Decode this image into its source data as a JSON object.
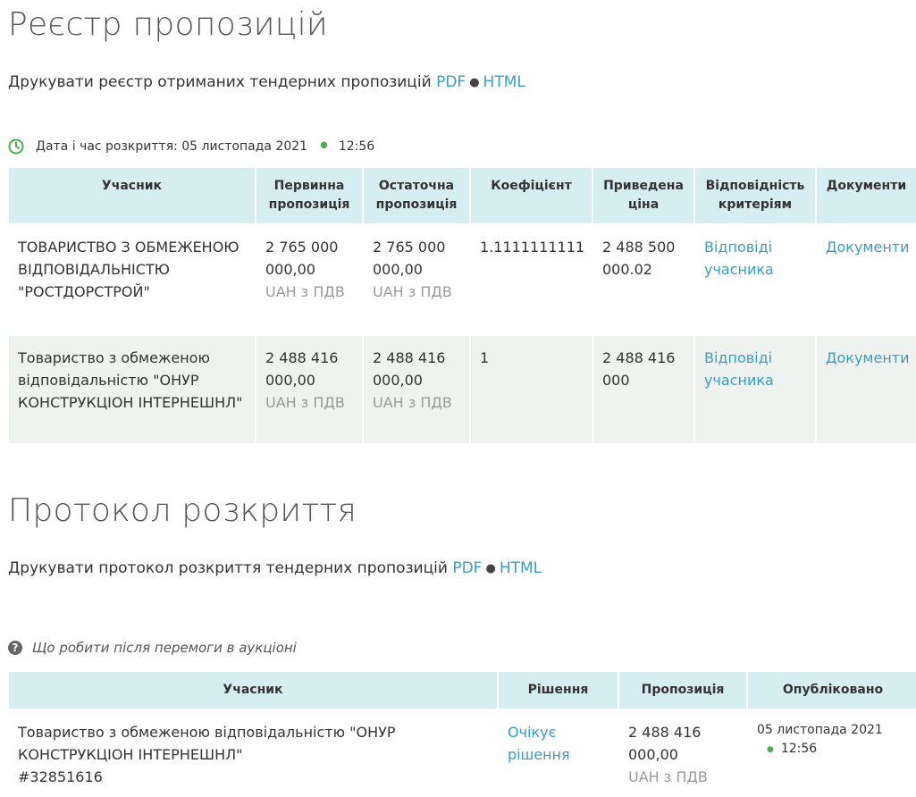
{
  "registry": {
    "title": "Реєстр пропозицій",
    "print_text": "Друкувати реєстр отриманих тендерних пропозицій",
    "pdf_label": "PDF",
    "separator": "●",
    "html_label": "HTML",
    "opening_label": "Дата і час розкриття: 05 листопада 2021",
    "opening_time": "12:56",
    "columns": [
      "Учасник",
      "Первинна пропозиція",
      "Остаточна пропозиція",
      "Коефіцієнт",
      "Приведена ціна",
      "Відповідність критеріям",
      "Документи"
    ],
    "rows": [
      {
        "participant": "ТОВАРИСТВО З ОБМЕЖЕНОЮ ВІДПОВІДАЛЬНІСТЮ \"РОСТДОРСТРОЙ\"",
        "initial": "2 765 000 000,00",
        "initial_cur": "UAH з ПДВ",
        "final": "2 765 000 000,00",
        "final_cur": "UAH з ПДВ",
        "coefficient": "1.1111111111",
        "reduced": "2 488 500 000.02",
        "compliance": "Відповіді учасника",
        "documents": "Документи"
      },
      {
        "participant": "Товариство з обмеженою відповідальністю \"ОНУР КОНСТРУКЦІОН ІНТЕРНЕШНЛ\"",
        "initial": "2 488 416 000,00",
        "initial_cur": "UAH з ПДВ",
        "final": "2 488 416 000,00",
        "final_cur": "UAH з ПДВ",
        "coefficient": "1",
        "reduced": "2 488 416 000",
        "compliance": "Відповіді учасника",
        "documents": "Документи"
      }
    ]
  },
  "protocol": {
    "title": "Протокол розкриття",
    "print_text": "Друкувати протокол розкриття тендерних пропозицій",
    "pdf_label": "PDF",
    "separator": "●",
    "html_label": "HTML",
    "help_text": "Що робити після перемоги в аукціоні",
    "columns": [
      "Учасник",
      "Рішення",
      "Пропозиція",
      "Опубліковано"
    ],
    "rows": [
      {
        "participant": "Товариство з обмеженою відповідальністю \"ОНУР КОНСТРУКЦІОН ІНТЕРНЕШНЛ\"",
        "participant_id": "#32851616",
        "decision": "Очікує рішення",
        "offer": "2 488 416 000,00",
        "offer_cur": "UAH з ПДВ",
        "published_date": "05 листопада 2021",
        "published_time": "12:56"
      }
    ]
  },
  "colors": {
    "link": "#3b9bc9",
    "header_bg": "#d6edf2",
    "row_alt_bg": "#eef3ef",
    "accent_green": "#4caf50"
  },
  "icons": {
    "opening": "clock-icon",
    "help": "question-circle-icon"
  }
}
